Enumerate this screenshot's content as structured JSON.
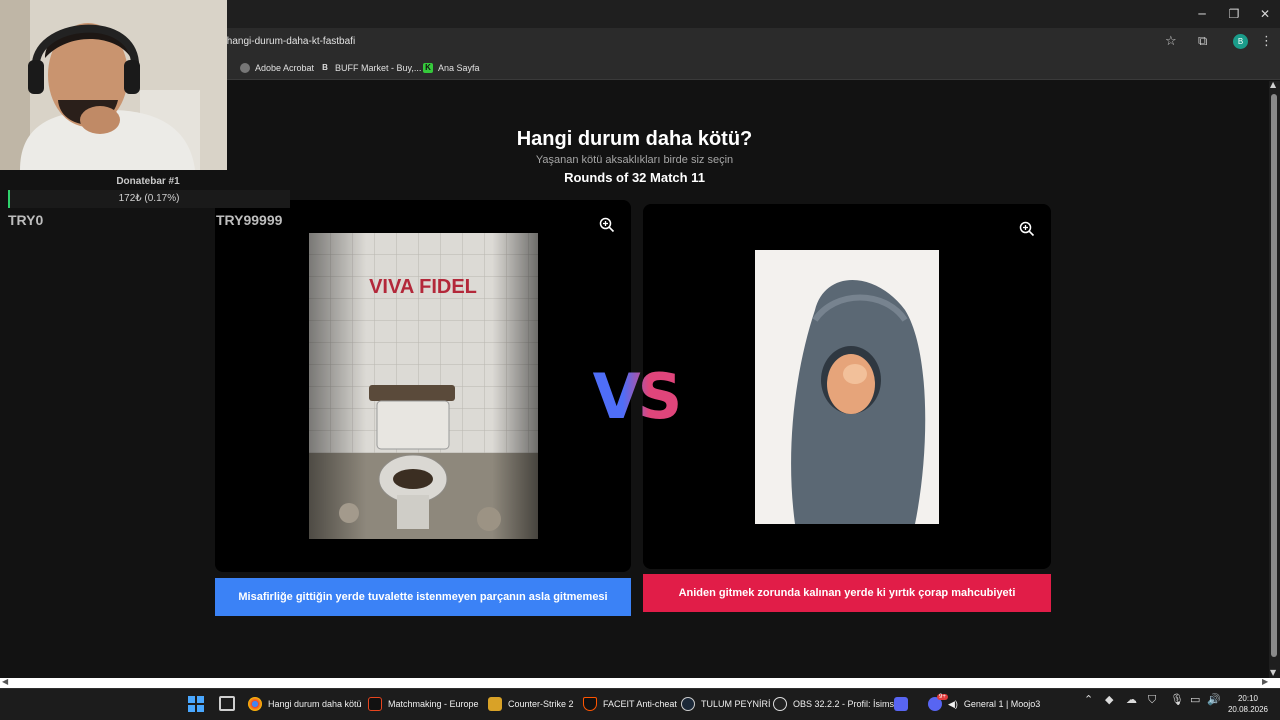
{
  "browser": {
    "url": "/hangi-durum-daha-kt-fastbafi",
    "bookmarks": [
      "Adobe Acrobat",
      "BUFF Market - Buy,...",
      "Ana Sayfa"
    ],
    "profile_initial": "B"
  },
  "page": {
    "title": "Hangi durum daha kötü?",
    "subtitle": "Yaşanan kötü aksaklıkları birde siz seçin",
    "rounds": "Rounds of 32 Match 11",
    "vs": "VS",
    "left_image_text": "VIVA FIDEL",
    "left_choice": "Misafirliğe gittiğin yerde tuvalette istenmeyen parçanın asla gitmemesi",
    "right_choice": "Aniden gitmek zorunda kalınan yerde ki yırtık çorap mahcubiyeti",
    "colors": {
      "left_button": "#3b82f6",
      "right_button": "#e11d48",
      "vs_from": "#4f6ef7",
      "vs_to": "#e0457b"
    }
  },
  "overlay": {
    "donate_title": "Donatebar #1",
    "donate_value": "172₺ (0.17%)",
    "donate_progress_percent": 0.17,
    "try_left": "TRY0",
    "try_right": "TRY99999"
  },
  "taskbar": {
    "items": [
      "Hangi durum daha kötü",
      "Matchmaking - Europe",
      "Counter-Strike 2",
      "FACEIT Anti-cheat",
      "TULUM PEYNİRİ",
      "OBS 32.2.2 - Profil: İsims",
      "General 1 | Moojo3"
    ],
    "discord_badge": "9+",
    "time": "20:10",
    "date": "20.08.2026"
  }
}
